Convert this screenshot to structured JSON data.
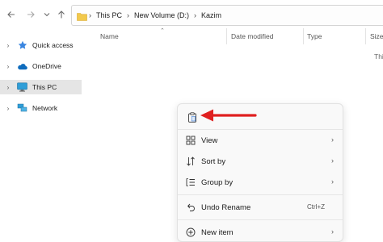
{
  "nav": {
    "back_icon": "arrow-left",
    "forward_icon": "arrow-right",
    "recent_icon": "chevron-down",
    "up_icon": "arrow-up"
  },
  "address": {
    "folder_icon": "folder",
    "crumbs": [
      "This PC",
      "New Volume (D:)",
      "Kazim"
    ]
  },
  "sidebar": {
    "items": [
      {
        "label": "Quick access",
        "icon": "star-icon",
        "expand": "›",
        "selected": false
      },
      {
        "label": "OneDrive",
        "icon": "cloud-icon",
        "expand": "›",
        "selected": false
      },
      {
        "label": "This PC",
        "icon": "monitor-icon",
        "expand": "›",
        "selected": true
      },
      {
        "label": "Network",
        "icon": "network-icon",
        "expand": "›",
        "selected": false
      }
    ]
  },
  "columns": {
    "name": "Name",
    "date_modified": "Date modified",
    "type": "Type",
    "size": "Size"
  },
  "content": {
    "empty_text": "This"
  },
  "context_menu": {
    "items": [
      {
        "label": "",
        "icon": "paste-icon"
      },
      {
        "label": "View",
        "icon": "view-grid-icon",
        "submenu": true
      },
      {
        "label": "Sort by",
        "icon": "sort-icon",
        "submenu": true
      },
      {
        "label": "Group by",
        "icon": "group-by-icon",
        "submenu": true
      },
      {
        "label": "Undo Rename",
        "icon": "undo-icon",
        "shortcut": "Ctrl+Z"
      },
      {
        "label": "New item",
        "icon": "new-item-icon",
        "submenu": true
      }
    ]
  },
  "annotation": {
    "arrow_color": "#e02020"
  },
  "colors": {
    "selected_bg": "#e5e5e5",
    "menu_bg": "#f9f9f9",
    "folder_yellow": "#f2c94c",
    "onedrive_blue": "#0f6cbd"
  }
}
